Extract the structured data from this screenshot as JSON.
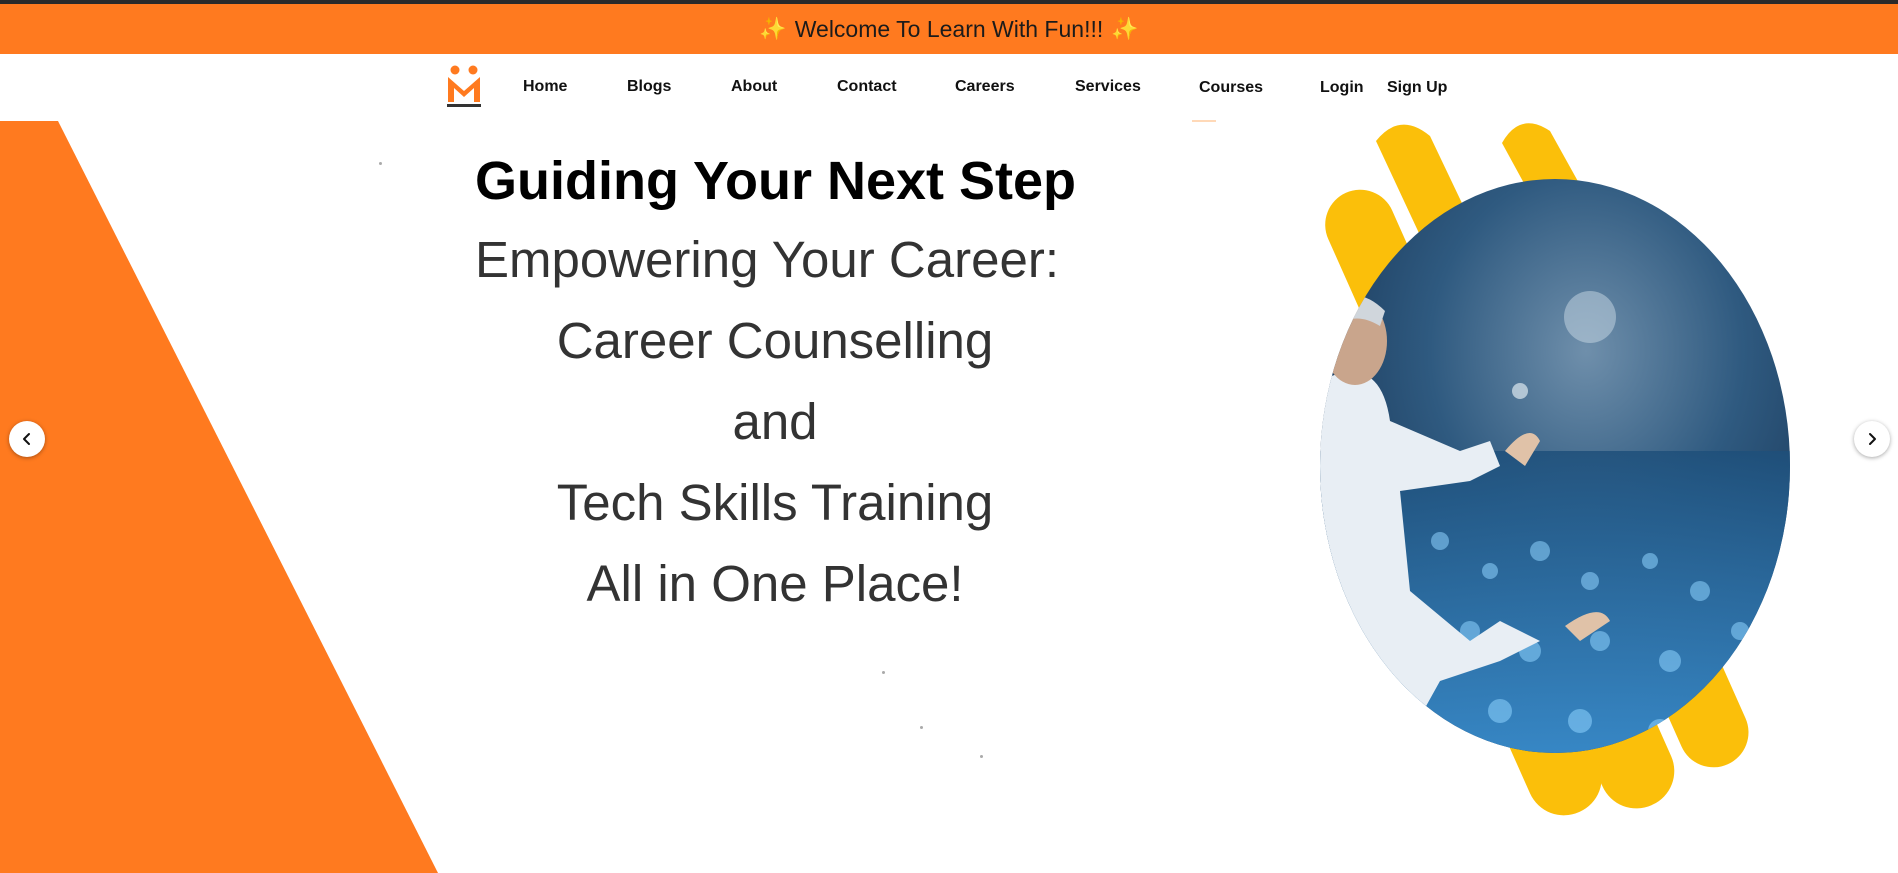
{
  "announcement": {
    "text": "Welcome To Learn With Fun!!!",
    "spark_left": "✨",
    "spark_right": "✨"
  },
  "brand": {
    "logo_icon": "mentorshield-logo-icon",
    "accent_color": "#FF7A1F",
    "secondary_color": "#FBBF0A"
  },
  "nav": {
    "home": "Home",
    "blogs": "Blogs",
    "about": "About",
    "contact": "Contact",
    "careers": "Careers",
    "services": "Services",
    "courses": "Courses",
    "login": "Login",
    "signup": "Sign Up"
  },
  "hero": {
    "title": "Guiding Your Next Step",
    "lines": [
      "Empowering Your Career:",
      "Career Counselling",
      "and",
      "Tech Skills Training",
      "All in One Place!"
    ],
    "image_subject": "speaker-on-stage-image"
  },
  "carousel": {
    "prev_icon": "chevron-left-icon",
    "next_icon": "chevron-right-icon"
  }
}
